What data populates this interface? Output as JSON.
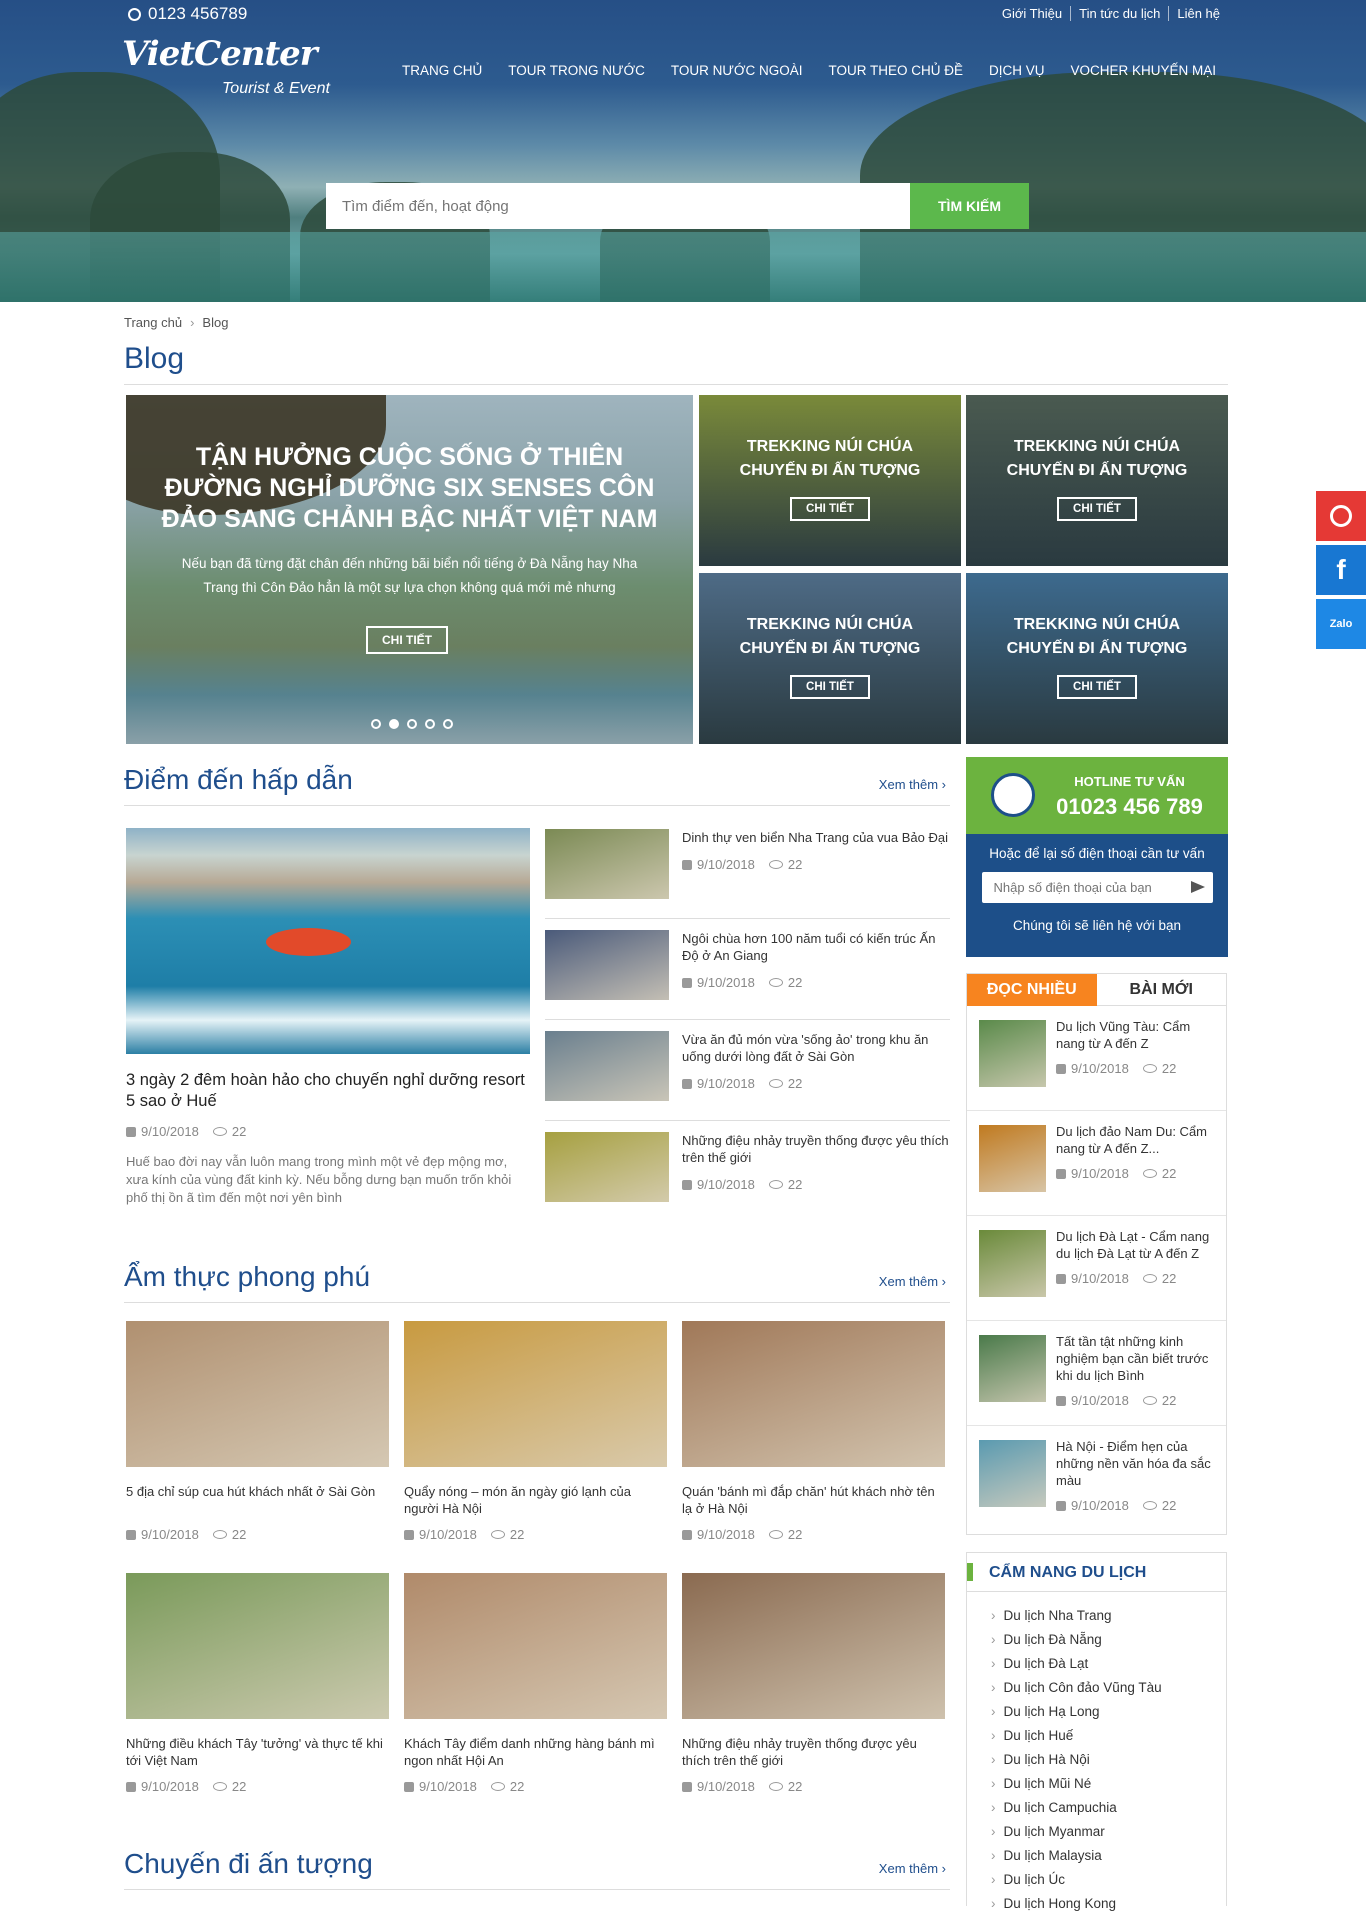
{
  "topbar": {
    "phone": "0123 456789",
    "links": [
      "Giới Thiệu",
      "Tin tức du lịch",
      "Liên hệ"
    ]
  },
  "logo": {
    "main": "VietCenter",
    "sub": "Tourist & Event"
  },
  "nav": [
    "TRANG CHỦ",
    "TOUR TRONG NƯỚC",
    "TOUR NƯỚC NGOÀI",
    "TOUR THEO CHỦ ĐỀ",
    "DỊCH VỤ",
    "VOCHER KHUYẾN MẠI"
  ],
  "search": {
    "placeholder": "Tìm điểm đến, hoạt động",
    "button": "TÌM KIẾM"
  },
  "breadcrumb": {
    "home": "Trang chủ",
    "current": "Blog"
  },
  "page_title": "Blog",
  "slider": {
    "title": "TẬN HƯỞNG CUỘC SỐNG Ở THIÊN ĐƯỜNG NGHỈ DƯỠNG SIX SENSES CÔN ĐẢO SANG CHẢNH BẬC NHẤT VIỆT NAM",
    "desc": "Nếu bạn đã từng đặt chân đến những bãi biển nổi tiếng ở Đà Nẵng hay Nha Trang thì Côn Đảo hẳn là một sự lựa chọn không quá mới mẻ nhưng",
    "button": "CHI TIẾT",
    "active_dot": 1
  },
  "tiles": [
    {
      "title": "TREKKING NÚI CHÚA CHUYẾN ĐI ẤN TƯỢNG",
      "button": "CHI TIẾT",
      "color": "#7a8a3a"
    },
    {
      "title": "TREKKING NÚI CHÚA CHUYẾN ĐI ẤN TƯỢNG",
      "button": "CHI TIẾT",
      "color": "#4a5a50"
    },
    {
      "title": "TREKKING NÚI CHÚA CHUYẾN ĐI ẤN TƯỢNG",
      "button": "CHI TIẾT",
      "color": "#4e6b86"
    },
    {
      "title": "TREKKING NÚI CHÚA CHUYẾN ĐI ẤN TƯỢNG",
      "button": "CHI TIẾT",
      "color": "#3d6a8e"
    }
  ],
  "section1": {
    "title": "Điểm đến hấp dẫn",
    "more": "Xem thêm",
    "featured": {
      "title": "3 ngày 2 đêm hoàn hảo cho chuyến nghỉ dưỡng resort 5 sao ở Huế",
      "date": "9/10/2018",
      "views": "22",
      "desc": "Huế bao đời nay vẫn luôn mang trong mình một vẻ đẹp mộng mơ, xưa kính của vùng đất kinh kỳ. Nếu bỗng dưng bạn muốn trốn khỏi phố thị ồn ã tìm đến một nơi yên bình"
    },
    "items": [
      {
        "title": "Dinh thự ven biển Nha Trang của vua Bảo Đại",
        "date": "9/10/2018",
        "views": "22",
        "color": "#7b8a54"
      },
      {
        "title": "Ngôi chùa hơn 100 năm tuổi có kiến trúc Ấn Độ ở An Giang",
        "date": "9/10/2018",
        "views": "22",
        "color": "#4a5a7a"
      },
      {
        "title": "Vừa ăn đủ món vừa 'sống ảo' trong khu ăn uống dưới lòng đất ở Sài Gòn",
        "date": "9/10/2018",
        "views": "22",
        "color": "#6a7f8e"
      },
      {
        "title": "Những điệu nhảy truyền thống được yêu thích trên thế giới",
        "date": "9/10/2018",
        "views": "22",
        "color": "#a6a040"
      }
    ]
  },
  "section2": {
    "title": "Ẩm thực phong phú",
    "more": "Xem thêm",
    "items": [
      {
        "title": "5 địa chỉ súp cua hút khách nhất ở Sài Gòn",
        "date": "9/10/2018",
        "views": "22",
        "color": "#b09070"
      },
      {
        "title": "Quẩy nóng – món ăn ngày gió lạnh của người Hà Nội",
        "date": "9/10/2018",
        "views": "22",
        "color": "#c89a40"
      },
      {
        "title": "Quán 'bánh mì đắp chăn' hút khách nhờ tên lạ ở Hà Nội",
        "date": "9/10/2018",
        "views": "22",
        "color": "#a07858"
      },
      {
        "title": "Những điều khách Tây 'tưởng' và thực tế khi tới Việt Nam",
        "date": "9/10/2018",
        "views": "22",
        "color": "#7a9a5a"
      },
      {
        "title": "Khách Tây điểm danh những hàng bánh mì ngon nhất Hội An",
        "date": "9/10/2018",
        "views": "22",
        "color": "#b08a6a"
      },
      {
        "title": "Những điệu nhảy truyền thống được yêu thích trên thế giới",
        "date": "9/10/2018",
        "views": "22",
        "color": "#8a6a50"
      }
    ]
  },
  "section3": {
    "title": "Chuyến đi ấn tượng",
    "more": "Xem thêm"
  },
  "hotline": {
    "label": "HOTLINE TƯ VẤN",
    "number": "01023 456 789",
    "note": "Hoặc để lại số điện thoại cần tư vấn",
    "placeholder": "Nhập số điện thoại của bạn",
    "note2": "Chúng tôi  sẽ liên hệ với bạn"
  },
  "tabs": {
    "active": "ĐỌC NHIỀU",
    "inactive": "BÀI MỚI",
    "items": [
      {
        "title": "Du lịch Vũng Tàu: Cẩm nang từ A đến Z",
        "date": "9/10/2018",
        "views": "22",
        "color": "#5a8a4a"
      },
      {
        "title": "Du lịch đảo Nam Du: Cẩm nang từ A đến Z...",
        "date": "9/10/2018",
        "views": "22",
        "color": "#c07a20"
      },
      {
        "title": "Du lịch Đà Lạt - Cẩm nang du lịch Đà Lạt từ A đến Z",
        "date": "9/10/2018",
        "views": "22",
        "color": "#6a8a3a"
      },
      {
        "title": "Tất tần tật những kinh nghiệm bạn cần biết trước khi du lịch Bình",
        "date": "9/10/2018",
        "views": "22",
        "color": "#4a7a4a"
      },
      {
        "title": "Hà Nội - Điểm hẹn của những nền văn hóa đa sắc màu",
        "date": "9/10/2018",
        "views": "22",
        "color": "#5a9ab0"
      }
    ]
  },
  "guide": {
    "title": "CẨM NANG DU LỊCH",
    "items": [
      "Du lịch Nha Trang",
      "Du lịch Đà Nẵng",
      "Du lịch Đà Lạt",
      "Du lịch Côn đảo Vũng Tàu",
      "Du lịch Hạ Long",
      "Du lịch Huế",
      "Du lịch Hà Nội",
      "Du lịch Mũi Né",
      "Du lịch Campuchia",
      "Du lịch Myanmar",
      "Du lịch Malaysia",
      "Du lịch Úc",
      "Du lịch Hong Kong"
    ]
  },
  "float": [
    {
      "icon": "phone-icon",
      "color": "#e53935"
    },
    {
      "icon": "facebook-icon",
      "label": "f",
      "color": "#1877d2"
    },
    {
      "icon": "zalo-icon",
      "label": "Zalo",
      "color": "#1e88e5"
    }
  ],
  "colors": {
    "brand_blue": "#1f4e8c",
    "green": "#5cb84c",
    "orange": "#f7841f"
  }
}
